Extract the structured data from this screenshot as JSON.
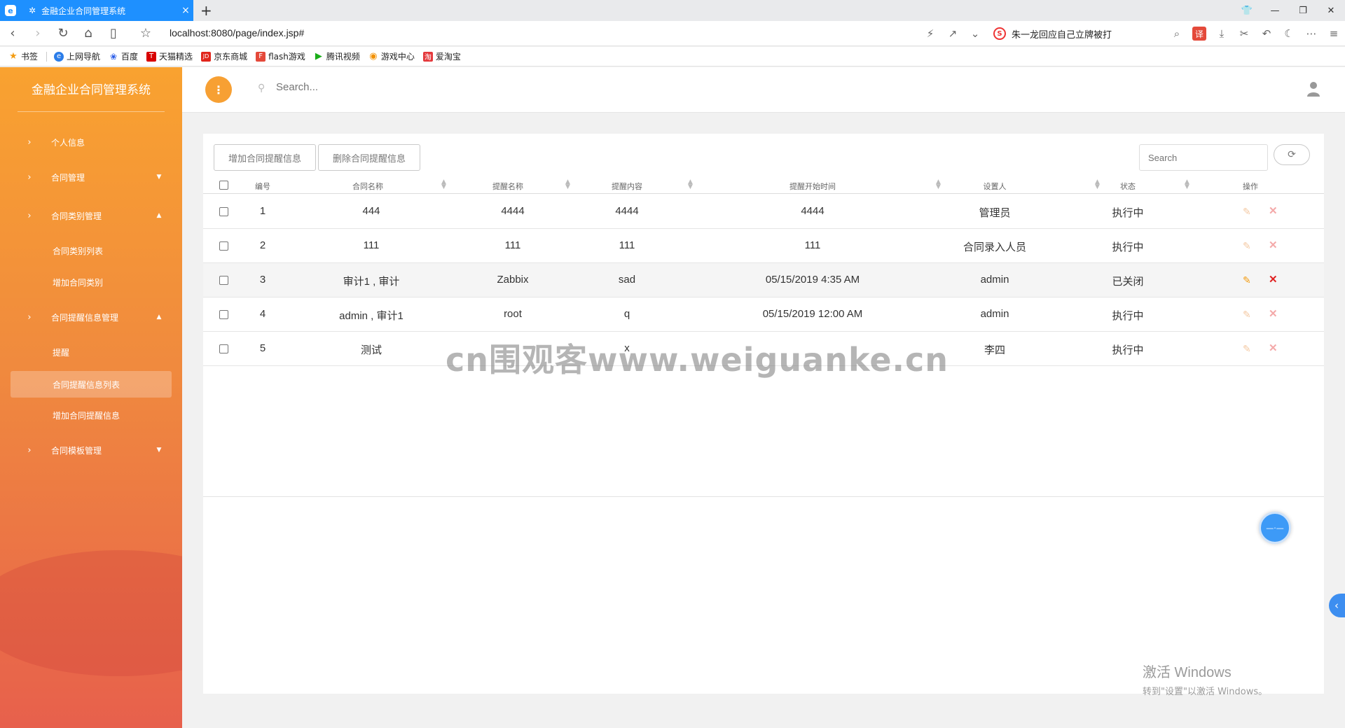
{
  "browser": {
    "tab_title": "金融企业合同管理系统",
    "tab_close": "×",
    "new_tab": "+",
    "url": "localhost:8080/page/index.jsp#",
    "hot_search": "朱一龙回应自己立牌被打",
    "translate_label": "译",
    "bookmarks": [
      {
        "label": "书签",
        "icon": "star-icon",
        "color": "#f39c12"
      },
      {
        "label": "上网导航",
        "icon": "e-icon",
        "color": "#2b7de9"
      },
      {
        "label": "百度",
        "icon": "paw-icon",
        "color": "#2a5ce8"
      },
      {
        "label": "天猫精选",
        "icon": "tmall-icon",
        "color": "#d80000"
      },
      {
        "label": "京东商城",
        "icon": "jd-icon",
        "color": "#e1251b"
      },
      {
        "label": "flash游戏",
        "icon": "flash-icon",
        "color": "#e4493a"
      },
      {
        "label": "腾讯视频",
        "icon": "play-icon",
        "color": "#1aad19"
      },
      {
        "label": "游戏中心",
        "icon": "gamepad-icon",
        "color": "#f29100"
      },
      {
        "label": "爱淘宝",
        "icon": "taobao-icon",
        "color": "#e4393c"
      }
    ]
  },
  "sidebar": {
    "brand": "金融企业合同管理系统",
    "items": [
      {
        "label": "个人信息",
        "arrow": "›",
        "caret": ""
      },
      {
        "label": "合同管理",
        "arrow": "›",
        "caret": "▼"
      },
      {
        "label": "合同类别管理",
        "arrow": "›",
        "caret": "▲"
      },
      {
        "label": "合同类别列表"
      },
      {
        "label": "增加合同类别"
      },
      {
        "label": "合同提醒信息管理",
        "arrow": "›",
        "caret": "▲"
      },
      {
        "label": "提醒"
      },
      {
        "label": "合同提醒信息列表"
      },
      {
        "label": "增加合同提醒信息"
      },
      {
        "label": "合同模板管理",
        "arrow": "›",
        "caret": "▼"
      }
    ]
  },
  "header": {
    "search_placeholder": "Search...",
    "more_icon": "⋮"
  },
  "toolbar": {
    "add_label": "增加合同提醒信息",
    "delete_label": "删除合同提醒信息",
    "search_placeholder": "Search",
    "refresh_icon": "⟳"
  },
  "table": {
    "columns": [
      "编号",
      "合同名称",
      "提醒名称",
      "提醒内容",
      "提醒开始时间",
      "设置人",
      "状态",
      "操作"
    ],
    "rows": [
      {
        "id": "1",
        "contract": "444",
        "name": "4444",
        "content": "4444",
        "start": "4444",
        "setter": "管理员",
        "status": "执行中"
      },
      {
        "id": "2",
        "contract": "111",
        "name": "111",
        "content": "111",
        "start": "111",
        "setter": "合同录入人员",
        "status": "执行中"
      },
      {
        "id": "3",
        "contract": "审计1 , 审计",
        "name": "Zabbix",
        "content": "sad",
        "start": "05/15/2019 4:35 AM",
        "setter": "admin",
        "status": "已关闭"
      },
      {
        "id": "4",
        "contract": "admin , 审计1",
        "name": "root",
        "content": "q",
        "start": "05/15/2019 12:00 AM",
        "setter": "admin",
        "status": "执行中"
      },
      {
        "id": "5",
        "contract": "测试",
        "name": "",
        "content": "x",
        "start": "",
        "setter": "李四",
        "status": "执行中"
      }
    ]
  },
  "overlay": {
    "watermark": "cn围观客www.weiguanke.cn",
    "activate_title": "激活 Windows",
    "activate_hint": "转到\"设置\"以激活 Windows。"
  }
}
